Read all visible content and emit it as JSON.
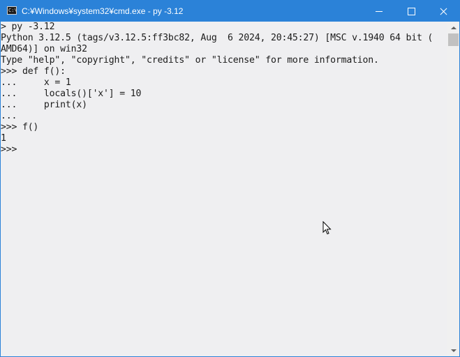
{
  "window": {
    "title": "C:¥Windows¥system32¥cmd.exe - py  -3.12",
    "icon": "cmd-icon",
    "icon_label": "C:\\",
    "controls": {
      "minimize": "minimize-icon",
      "maximize": "maximize-icon",
      "close": "close-icon"
    }
  },
  "console": {
    "lines": [
      "> py -3.12",
      "Python 3.12.5 (tags/v3.12.5:ff3bc82, Aug  6 2024, 20:45:27) [MSC v.1940 64 bit (",
      "AMD64)] on win32",
      "Type \"help\", \"copyright\", \"credits\" or \"license\" for more information.",
      ">>> def f():",
      "...     x = 1",
      "...     locals()['x'] = 10",
      "...     print(x)",
      "...",
      ">>> f()",
      "1",
      ">>>"
    ]
  },
  "colors": {
    "titlebar": "#2b82d8",
    "console_bg": "#efeff1",
    "console_text": "#1c1c1c"
  }
}
